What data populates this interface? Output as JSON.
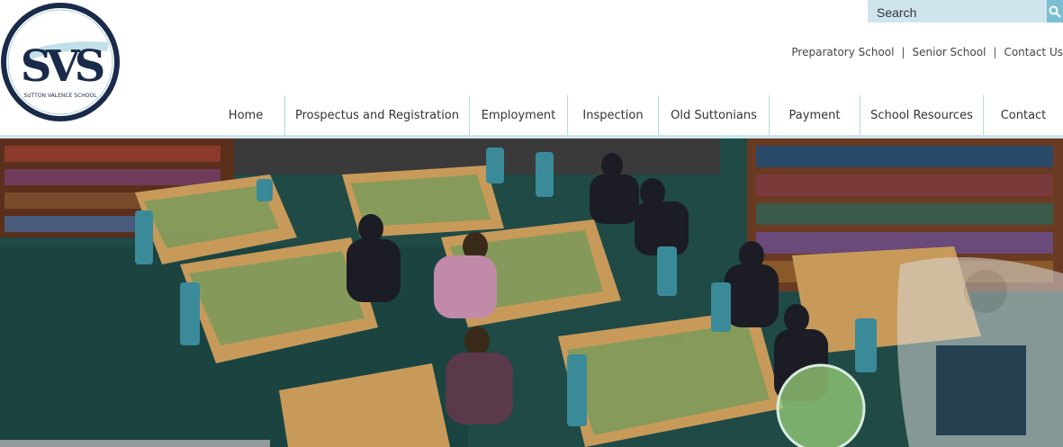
{
  "logo": {
    "monogram": "SVS",
    "ring_text": "SUTTON VALENCE SCHOOL"
  },
  "search": {
    "placeholder": "Search"
  },
  "top_links": [
    {
      "label": "Preparatory School"
    },
    {
      "label": "Senior School"
    },
    {
      "label": "Contact Us"
    }
  ],
  "nav": [
    {
      "label": "Home"
    },
    {
      "label": "Prospectus and Registration"
    },
    {
      "label": "Employment"
    },
    {
      "label": "Inspection"
    },
    {
      "label": "Old Suttonians"
    },
    {
      "label": "Payment"
    },
    {
      "label": "School Resources"
    },
    {
      "label": "Contact"
    }
  ],
  "hero": {
    "icon": "library-photo"
  },
  "colors": {
    "navy": "#1a2a4a",
    "accent_light": "#cfe5ee",
    "accent": "#7bbfd1",
    "text": "#333333"
  }
}
